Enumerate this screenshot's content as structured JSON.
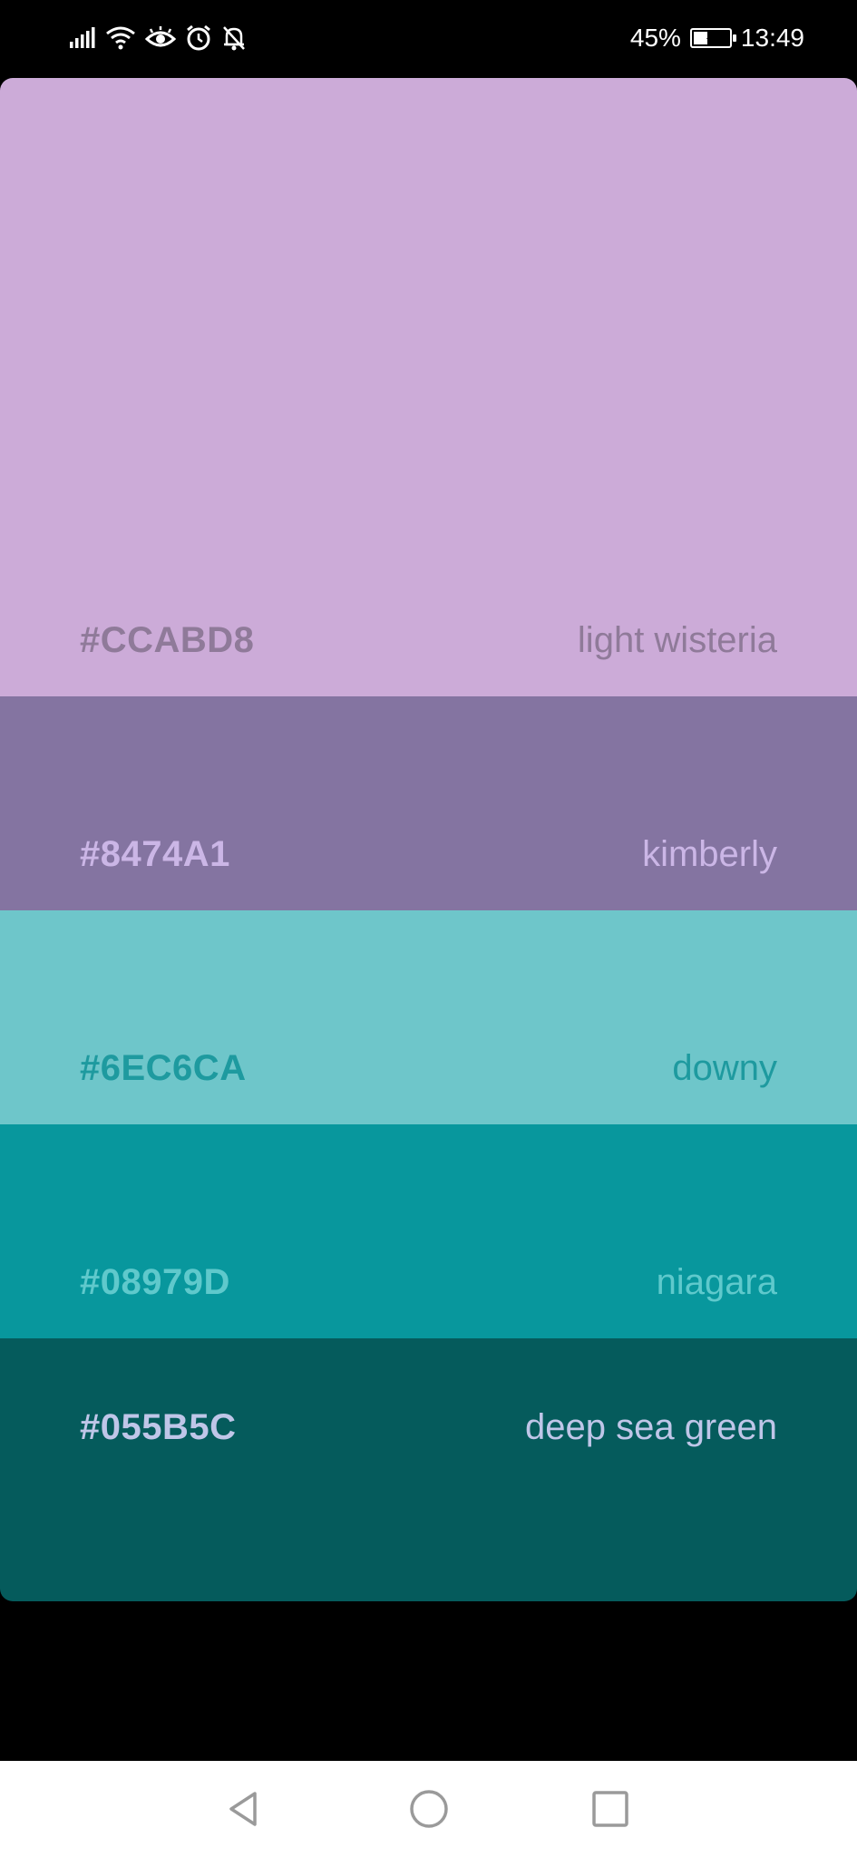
{
  "status_bar": {
    "battery_percent": "45%",
    "battery_level": 0.45,
    "time": "13:49",
    "icons": [
      "signal-icon",
      "wifi-icon",
      "eye-comfort-icon",
      "alarm-icon",
      "mute-notifications-icon",
      "battery-charging-icon"
    ]
  },
  "palette": {
    "swatches": [
      {
        "hex": "#CCABD8",
        "name": "light wisteria",
        "bg": "#CCABD8",
        "text_color": "#8F7A99"
      },
      {
        "hex": "#8474A1",
        "name": "kimberly",
        "bg": "#8474A1",
        "text_color": "#CBB6E6"
      },
      {
        "hex": "#6EC6CA",
        "name": "downy",
        "bg": "#6EC6CA",
        "text_color": "#1E9A9F"
      },
      {
        "hex": "#08979D",
        "name": "niagara",
        "bg": "#08979D",
        "text_color": "#5FC9CC"
      },
      {
        "hex": "#055B5C",
        "name": "deep sea green",
        "bg": "#055B5C",
        "text_color": "#BFC6E8"
      }
    ]
  },
  "nav_bar": {
    "icons": [
      "back-icon",
      "home-icon",
      "recent-apps-icon"
    ],
    "icon_color": "#9A9A9A"
  }
}
